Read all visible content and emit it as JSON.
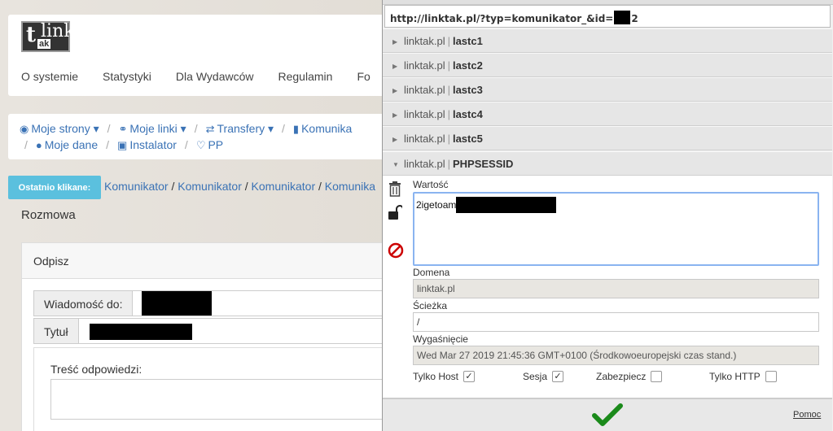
{
  "site": {
    "logo_text": "link",
    "logo_small": "t",
    "logo_sub": "ak",
    "nav": [
      "O systemie",
      "Statystyki",
      "Dla Wydawców",
      "Regulamin",
      "Fo"
    ],
    "subnav_row1": [
      "Moje strony",
      "Moje linki",
      "Transfery",
      "Komunika"
    ],
    "subnav_row2": [
      "Moje dane",
      "Instalator",
      "PP"
    ],
    "recent_label": "Ostatnio klikane:",
    "recent_links": [
      "Komunikator",
      "Komunikator",
      "Komunikator",
      "Komunika"
    ],
    "rozmowa": "Rozmowa",
    "panel_title": "Odpisz",
    "to_label": "Wiadomość do:",
    "title_label": "Tytuł",
    "body_label": "Treść odpowiedzi:"
  },
  "popup": {
    "url_prefix": "http://linktak.pl/?typ=komunikator_&id=",
    "url_suffix": "2",
    "cookies": [
      {
        "domain": "linktak.pl",
        "name": "lastc1"
      },
      {
        "domain": "linktak.pl",
        "name": "lastc2"
      },
      {
        "domain": "linktak.pl",
        "name": "lastc3"
      },
      {
        "domain": "linktak.pl",
        "name": "lastc4"
      },
      {
        "domain": "linktak.pl",
        "name": "lastc5"
      },
      {
        "domain": "linktak.pl",
        "name": "PHPSESSID"
      }
    ],
    "editor": {
      "value_label": "Wartość",
      "value_prefix": "2igetoam",
      "domain_label": "Domena",
      "domain_value": "linktak.pl",
      "path_label": "Ścieżka",
      "path_value": "/",
      "expiry_label": "Wygaśnięcie",
      "expiry_value": "Wed Mar 27 2019 21:45:36 GMT+0100 (Środkowoeuropejski czas stand.)",
      "host_only_label": "Tylko Host",
      "session_label": "Sesja",
      "secure_label": "Zabezpiecz",
      "http_only_label": "Tylko HTTP",
      "host_only_checked": true,
      "session_checked": true,
      "secure_checked": false,
      "http_only_checked": false
    },
    "help_label": "Pomoc",
    "accent_green": "#1a8a1a",
    "accent_red": "#cc0000"
  }
}
